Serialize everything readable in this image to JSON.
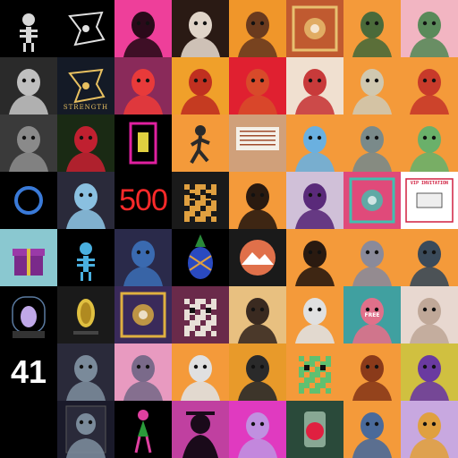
{
  "collage": {
    "columns": 8,
    "rows": 8,
    "tiles": [
      {
        "bg": "#000000",
        "fg": "#d8d8d8",
        "motif": "skeleton",
        "text": ""
      },
      {
        "bg": "#000000",
        "fg": "#e0e0e0",
        "motif": "emblem",
        "text": ""
      },
      {
        "bg": "#ee3f9a",
        "fg": "#2a0a1a",
        "motif": "hooded-figure",
        "text": ""
      },
      {
        "bg": "#2a1a14",
        "fg": "#e0d4c8",
        "motif": "portrait-woman",
        "text": ""
      },
      {
        "bg": "#f0962a",
        "fg": "#6a3a1e",
        "motif": "character-bust",
        "text": ""
      },
      {
        "bg": "#c05a30",
        "fg": "#e8c070",
        "motif": "pattern",
        "text": ""
      },
      {
        "bg": "#f49a3a",
        "fg": "#4a6a3a",
        "motif": "robot-head",
        "text": ""
      },
      {
        "bg": "#f2b5c2",
        "fg": "#5a8a5a",
        "motif": "zombie-head",
        "text": ""
      },
      {
        "bg": "#2a2a2a",
        "fg": "#bfbfbf",
        "motif": "portrait-gray",
        "text": ""
      },
      {
        "bg": "#141a26",
        "fg": "#e8c060",
        "motif": "emblem",
        "text": "STRENGTH"
      },
      {
        "bg": "#8a2a5a",
        "fg": "#e83a3a",
        "motif": "chef-bird",
        "text": ""
      },
      {
        "bg": "#f0a02a",
        "fg": "#c03020",
        "motif": "scene",
        "text": ""
      },
      {
        "bg": "#e02030",
        "fg": "#d84a2a",
        "motif": "dino",
        "text": ""
      },
      {
        "bg": "#f0e0d0",
        "fg": "#c83a3a",
        "motif": "painting",
        "text": ""
      },
      {
        "bg": "#f49a3a",
        "fg": "#d0c8b0",
        "motif": "ape-captain",
        "text": ""
      },
      {
        "bg": "#f49a3a",
        "fg": "#c83a2a",
        "motif": "elf-grin",
        "text": ""
      },
      {
        "bg": "#3a3a3a",
        "fg": "#8a8a8a",
        "motif": "robot-bust",
        "text": ""
      },
      {
        "bg": "#1a2a14",
        "fg": "#c02030",
        "motif": "astronaut-red",
        "text": ""
      },
      {
        "bg": "#000000",
        "fg": "#e020a0",
        "motif": "neon-frame",
        "text": ""
      },
      {
        "bg": "#f49a3a",
        "fg": "#2a2a2a",
        "motif": "runner",
        "text": ""
      },
      {
        "bg": "#d0a07a",
        "fg": "#a04a2a",
        "motif": "receipt",
        "text": ""
      },
      {
        "bg": "#f49a3a",
        "fg": "#6ab0e0",
        "motif": "mushroom-creature",
        "text": ""
      },
      {
        "bg": "#f49a3a",
        "fg": "#7a8a8a",
        "motif": "alien-head",
        "text": ""
      },
      {
        "bg": "#f49a3a",
        "fg": "#6ab06a",
        "motif": "zombie-head",
        "text": ""
      },
      {
        "bg": "#000000",
        "fg": "#3a7ad8",
        "motif": "ring",
        "text": ""
      },
      {
        "bg": "#2a2a3a",
        "fg": "#8ac0e0",
        "motif": "unicorn",
        "text": ""
      },
      {
        "bg": "#000000",
        "fg": "#ff2a2a",
        "motif": "number",
        "text": "500"
      },
      {
        "bg": "#1a1a1a",
        "fg": "#e0a040",
        "motif": "pixel-dog",
        "text": ""
      },
      {
        "bg": "#f49a3a",
        "fg": "#2a1a10",
        "motif": "bear-hood",
        "text": ""
      },
      {
        "bg": "#d0c0d8",
        "fg": "#5a2a7a",
        "motif": "robot-purple",
        "text": ""
      },
      {
        "bg": "#e04a7a",
        "fg": "#40c0b0",
        "motif": "ornate-pattern",
        "text": ""
      },
      {
        "bg": "#ffffff",
        "fg": "#d02040",
        "motif": "ticket",
        "text": "VIP INVITATION"
      },
      {
        "bg": "#8ac8d0",
        "fg": "#7a2a8a",
        "motif": "gift-box",
        "text": ""
      },
      {
        "bg": "#000000",
        "fg": "#4ab0e0",
        "motif": "blue-skeleton",
        "text": ""
      },
      {
        "bg": "#2a2a4a",
        "fg": "#3a6ab0",
        "motif": "character-bust",
        "text": ""
      },
      {
        "bg": "#000000",
        "fg": "#2a4ac0",
        "motif": "pineapple",
        "text": ""
      },
      {
        "bg": "#1a1a1a",
        "fg": "#e0704a",
        "motif": "circle-badge",
        "text": ""
      },
      {
        "bg": "#f49a3a",
        "fg": "#2a1a10",
        "motif": "cat-suit",
        "text": ""
      },
      {
        "bg": "#f49a3a",
        "fg": "#8a8a9a",
        "motif": "wolf-head",
        "text": ""
      },
      {
        "bg": "#f49a3a",
        "fg": "#3a4a5a",
        "motif": "rat-tophat",
        "text": ""
      },
      {
        "bg": "#000000",
        "fg": "#c0a8e8",
        "motif": "egg-pedestal",
        "text": ""
      },
      {
        "bg": "#1a1a1a",
        "fg": "#e0c040",
        "motif": "gold-coin",
        "text": ""
      },
      {
        "bg": "#3a2a5a",
        "fg": "#e0b040",
        "motif": "rune-art",
        "text": ""
      },
      {
        "bg": "#6a2a4a",
        "fg": "#e8e0d8",
        "motif": "pixel-ghost",
        "text": ""
      },
      {
        "bg": "#e8c080",
        "fg": "#3a2a20",
        "motif": "portrait-blonde",
        "text": ""
      },
      {
        "bg": "#f49a3a",
        "fg": "#e0e0e0",
        "motif": "skull-mushroom",
        "text": ""
      },
      {
        "bg": "#40a0a0",
        "fg": "#e0708a",
        "motif": "ogre",
        "text": "FREE"
      },
      {
        "bg": "#e8d8d0",
        "fg": "#c0a898",
        "motif": "anime-sketch",
        "text": ""
      },
      {
        "bg": "#000000",
        "fg": "#ffffff",
        "motif": "number",
        "text": "41"
      },
      {
        "bg": "#2a2a3a",
        "fg": "#7a8a9a",
        "motif": "cat-bust",
        "text": ""
      },
      {
        "bg": "#e89ac0",
        "fg": "#7a6a8a",
        "motif": "tophat",
        "text": ""
      },
      {
        "bg": "#f49a3a",
        "fg": "#e0e0e0",
        "motif": "mohawk-ghost",
        "text": ""
      },
      {
        "bg": "#e89a2a",
        "fg": "#2a2a2a",
        "motif": "leopard",
        "text": ""
      },
      {
        "bg": "#f49a3a",
        "fg": "#60c070",
        "motif": "punk-pixel",
        "text": ""
      },
      {
        "bg": "#f49a3a",
        "fg": "#8a3a1a",
        "motif": "viking",
        "text": ""
      },
      {
        "bg": "#d0c040",
        "fg": "#6a3aa0",
        "motif": "jester",
        "text": ""
      },
      {
        "bg": "#000000",
        "fg": "#bbbbbb",
        "motif": "text-list",
        "text": ""
      },
      {
        "bg": "#1a1a2a",
        "fg": "#e0e0e0",
        "motif": "document",
        "text": ""
      },
      {
        "bg": "#000000",
        "fg": "#e040a0",
        "motif": "dancer",
        "text": ""
      },
      {
        "bg": "#c040a0",
        "fg": "#1a0a1a",
        "motif": "silhouette",
        "text": ""
      },
      {
        "bg": "#e03ac0",
        "fg": "#c090e0",
        "motif": "masked-hero",
        "text": ""
      },
      {
        "bg": "#2a4a3a",
        "fg": "#e02040",
        "motif": "potion-jar",
        "text": ""
      },
      {
        "bg": "#f49a3a",
        "fg": "#4a6a9a",
        "motif": "goat-cap",
        "text": ""
      },
      {
        "bg": "#c8a8e0",
        "fg": "#e0a040",
        "motif": "cat-gold",
        "text": ""
      }
    ]
  }
}
